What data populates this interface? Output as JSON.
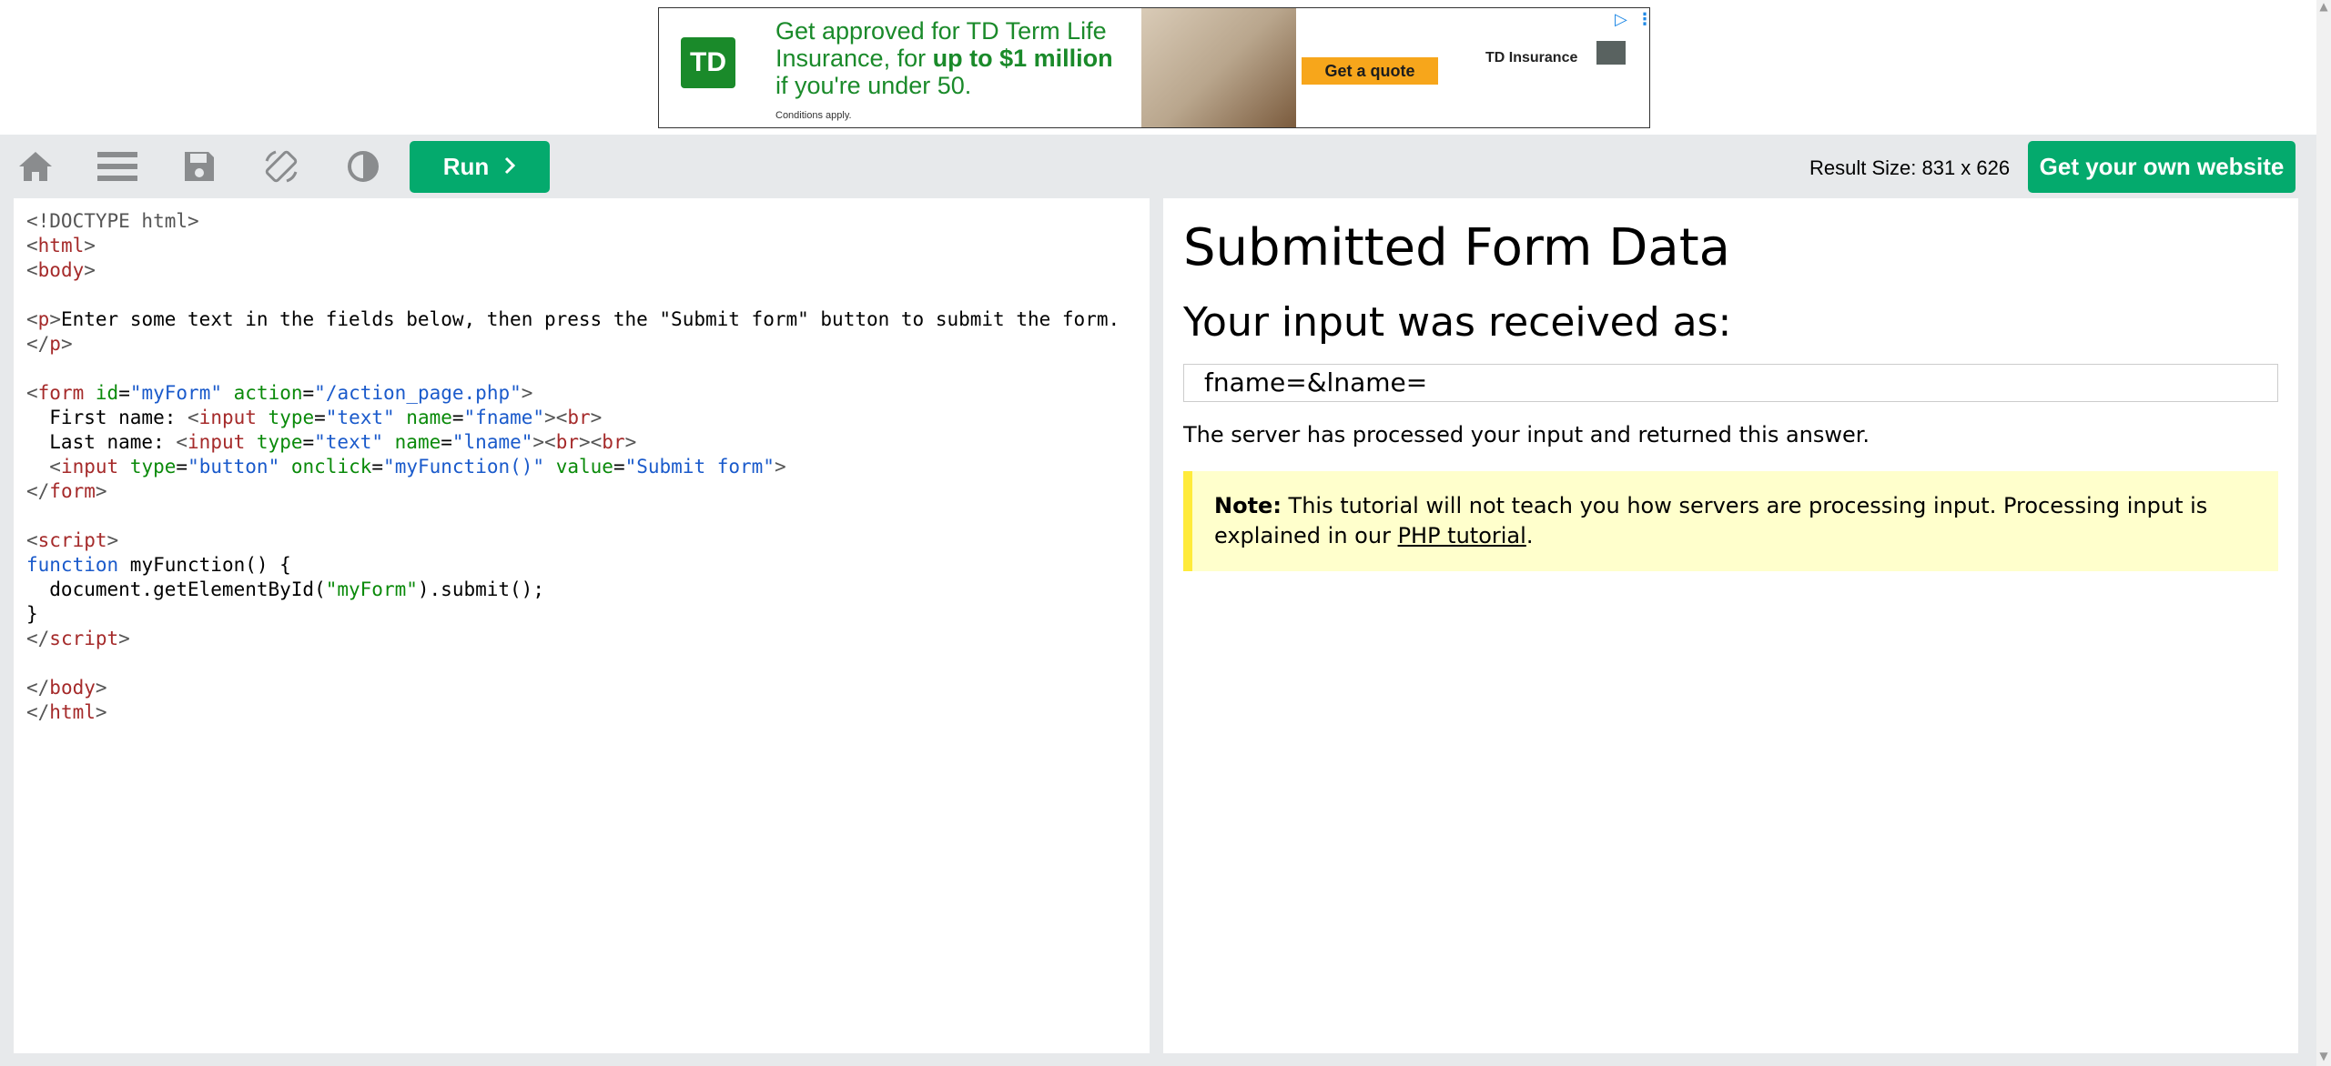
{
  "ad": {
    "logo": "TD",
    "headline_1": "Get approved for TD Term Life",
    "headline_2": "Insurance, for ",
    "headline_bold": "up to $1 million",
    "headline_3": "if you're under 50.",
    "conditions": "Conditions apply.",
    "cta": "Get a quote",
    "brand": "TD Insurance"
  },
  "toolbar": {
    "run_label": "Run",
    "result_size": "Result Size: 831 x 626",
    "own_website_label": "Get your own website"
  },
  "result": {
    "title": "Submitted Form Data",
    "subtitle": "Your input was received as:",
    "received_value": "fname=&lname=",
    "answer_text": "The server has processed your input and returned this answer.",
    "note_label": "Note:",
    "note_text": " This tutorial will not teach you how servers are processing input. Processing input is explained in our ",
    "note_link": "PHP tutorial",
    "note_end": "."
  }
}
